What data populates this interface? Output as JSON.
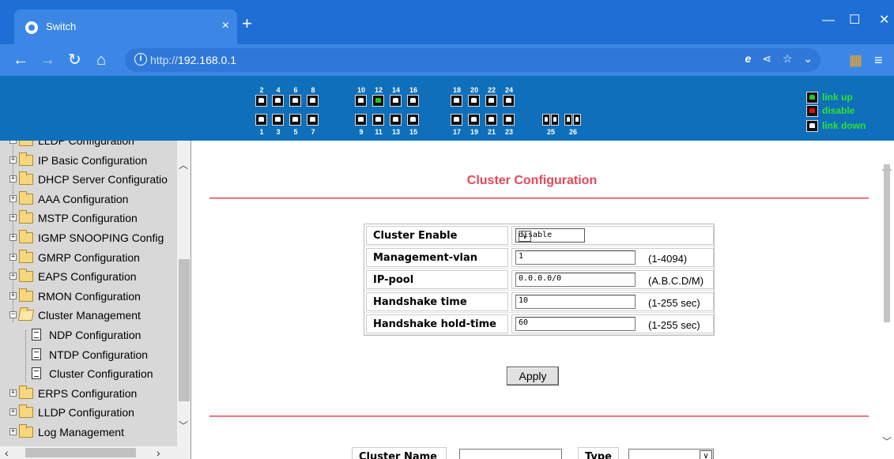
{
  "browser": {
    "tab_title": "Switch",
    "tab_close": "×",
    "new_tab": "+",
    "url_scheme": "http://",
    "url_host": "192.168.0.1",
    "window": {
      "minimize": "—",
      "maximize": "☐",
      "close": "✕"
    }
  },
  "panel": {
    "top_numbers": [
      "2",
      "4",
      "6",
      "8",
      "10",
      "12",
      "14",
      "16",
      "18",
      "20",
      "22",
      "24"
    ],
    "bottom_numbers": [
      "1",
      "3",
      "5",
      "7",
      "9",
      "11",
      "13",
      "15",
      "17",
      "19",
      "21",
      "23",
      "25",
      "26"
    ],
    "up_ports": [
      "12"
    ],
    "legend": {
      "up": "link up",
      "disable": "disable",
      "down": "link down"
    },
    "colors": {
      "up": "#2ec12e",
      "disable": "#e01010",
      "down": "#ffffff",
      "text": "#2ee52e"
    }
  },
  "sidebar": {
    "items": [
      {
        "label": "LLDP Configuration",
        "kind": "folder",
        "partial": true
      },
      {
        "label": "IP Basic Configuration",
        "kind": "folder"
      },
      {
        "label": "DHCP Server Configuratio",
        "kind": "folder"
      },
      {
        "label": "AAA Configuration",
        "kind": "folder"
      },
      {
        "label": "MSTP Configuration",
        "kind": "folder"
      },
      {
        "label": "IGMP SNOOPING Config",
        "kind": "folder"
      },
      {
        "label": "GMRP Configuration",
        "kind": "folder"
      },
      {
        "label": "EAPS Configuration",
        "kind": "folder"
      },
      {
        "label": "RMON Configuration",
        "kind": "folder"
      },
      {
        "label": "Cluster Management",
        "kind": "folder-open"
      },
      {
        "label": "NDP Configuration",
        "kind": "doc"
      },
      {
        "label": "NTDP Configuration",
        "kind": "doc"
      },
      {
        "label": "Cluster Configuration",
        "kind": "doc"
      },
      {
        "label": "ERPS Configuration",
        "kind": "folder"
      },
      {
        "label": "LLDP Configuration",
        "kind": "folder"
      },
      {
        "label": "Log Management",
        "kind": "folder"
      }
    ]
  },
  "main": {
    "title": "Cluster Configuration",
    "fields": [
      {
        "label": "Cluster Enable",
        "type": "select",
        "value": "disable",
        "range": ""
      },
      {
        "label": "Management-vlan",
        "type": "text",
        "value": "1",
        "range": "(1-4094)"
      },
      {
        "label": "IP-pool",
        "type": "text",
        "value": "0.0.0.0/0",
        "range": "(A.B.C.D/M)"
      },
      {
        "label": "Handshake time",
        "type": "text",
        "value": "10",
        "range": "(1-255 sec)"
      },
      {
        "label": "Handshake hold-time",
        "type": "text",
        "value": "60",
        "range": "(1-255 sec)"
      }
    ],
    "apply_label": "Apply",
    "bottom": {
      "name_label": "Cluster Name",
      "type_label": "Type"
    }
  },
  "accent": "#e8455a"
}
